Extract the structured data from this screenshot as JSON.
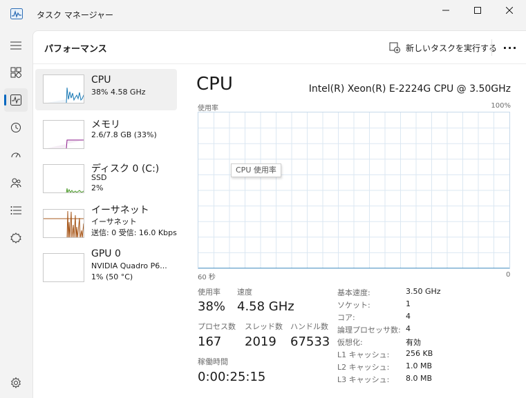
{
  "window": {
    "title": "タスク マネージャー"
  },
  "nav": {
    "items": [
      {
        "icon": "hamburger-menu-icon"
      },
      {
        "icon": "processes-icon"
      },
      {
        "icon": "performance-icon",
        "active": true
      },
      {
        "icon": "app-history-icon"
      },
      {
        "icon": "startup-apps-icon"
      },
      {
        "icon": "users-icon"
      },
      {
        "icon": "details-icon"
      },
      {
        "icon": "services-icon"
      },
      {
        "icon": "settings-icon"
      }
    ]
  },
  "header": {
    "title": "パフォーマンス",
    "run_task_label": "新しいタスクを実行する",
    "more_label": "···"
  },
  "resources": [
    {
      "name": "CPU",
      "line1": "38%  4.58 GHz",
      "line2": ""
    },
    {
      "name": "メモリ",
      "line1": "2.6/7.8 GB (33%)",
      "line2": ""
    },
    {
      "name": "ディスク 0 (C:)",
      "line1": "SSD",
      "line2": "2%"
    },
    {
      "name": "イーサネット",
      "line1": "イーサネット",
      "line2": "送信: 0  受信: 16.0 Kbps"
    },
    {
      "name": "GPU 0",
      "line1": "NVIDIA Quadro P6...",
      "line2": "1%  (50 °C)"
    }
  ],
  "detail": {
    "title": "CPU",
    "model": "Intel(R) Xeon(R) E-2224G CPU @ 3.50GHz",
    "graph_label_top_left": "使用率",
    "graph_label_top_right": "100%",
    "graph_label_bottom_left": "60 秒",
    "graph_label_bottom_right": "0",
    "tooltip": "CPU 使用率"
  },
  "stats": {
    "usage_label": "使用率",
    "usage_value": "38%",
    "speed_label": "速度",
    "speed_value": "4.58 GHz",
    "processes_label": "プロセス数",
    "processes_value": "167",
    "threads_label": "スレッド数",
    "threads_value": "2019",
    "handles_label": "ハンドル数",
    "handles_value": "67533",
    "uptime_label": "稼働時間",
    "uptime_value": "0:00:25:15"
  },
  "specs": [
    {
      "key": "基本速度:",
      "value": "3.50 GHz"
    },
    {
      "key": "ソケット:",
      "value": "1"
    },
    {
      "key": "コア:",
      "value": "4"
    },
    {
      "key": "論理プロセッサ数:",
      "value": "4"
    },
    {
      "key": "仮想化:",
      "value": "有効"
    },
    {
      "key": "L1 キャッシュ:",
      "value": "256 KB"
    },
    {
      "key": "L2 キャッシュ:",
      "value": "1.0 MB"
    },
    {
      "key": "L3 キャッシュ:",
      "value": "8.0 MB"
    }
  ],
  "colors": {
    "cpu": "#1a7ab5",
    "cpu_fill": "#f1f6fa",
    "memory": "#8b1a8b",
    "disk": "#4c9a2a",
    "ethernet": "#a7581c",
    "grid": "#dbe7f2"
  },
  "chart_data": {
    "type": "line",
    "ylim": [
      0,
      100
    ],
    "xlim": [
      60,
      0
    ],
    "x": [
      60,
      59,
      58,
      57,
      56,
      55,
      54,
      53,
      52,
      51,
      50,
      49,
      48,
      47,
      46,
      45,
      44,
      43,
      42,
      41,
      40,
      39,
      38,
      37,
      36,
      35,
      34,
      33,
      32,
      31,
      30,
      29,
      28,
      27,
      26,
      25,
      24,
      23,
      22,
      21,
      20,
      19,
      18,
      17,
      16,
      15,
      14,
      13,
      12,
      11,
      10,
      9,
      8,
      7,
      6,
      5,
      4,
      3,
      2,
      1,
      0
    ],
    "series": [
      {
        "values": [
          0,
          0,
          0,
          0,
          0,
          0,
          0,
          0,
          0,
          0,
          0,
          0,
          0,
          0,
          0,
          0,
          0,
          0,
          0,
          0,
          0,
          0,
          0,
          0,
          0,
          0,
          0,
          0,
          0,
          0,
          0,
          0,
          0,
          0,
          0,
          0,
          0,
          0,
          0,
          0,
          0,
          0,
          0,
          0,
          0,
          0,
          0,
          0,
          0,
          0,
          0,
          0,
          0,
          0,
          0,
          0,
          0,
          0,
          0,
          0,
          0
        ]
      },
      {
        "values": [
          0,
          0,
          0,
          0,
          0,
          0,
          0,
          0,
          0,
          0,
          0,
          0,
          0,
          0,
          0,
          0,
          0,
          0,
          0,
          0,
          0,
          0,
          0,
          0,
          0,
          0,
          0,
          0,
          0,
          0,
          0,
          0,
          0,
          0,
          0,
          0,
          0,
          0,
          0,
          0,
          0,
          0,
          0,
          0,
          0,
          0,
          0,
          0,
          0,
          0,
          0,
          0,
          0,
          0,
          0,
          0,
          0,
          0,
          0,
          0,
          0
        ]
      }
    ],
    "cpu_values": [
      0,
      0,
      0,
      0,
      0,
      0,
      0,
      0,
      0,
      0,
      0,
      0,
      0,
      0,
      0,
      0,
      0,
      0,
      0,
      0,
      0,
      0,
      0,
      0,
      0,
      0,
      0,
      0,
      0,
      0,
      0,
      0,
      0,
      0,
      0,
      0,
      0,
      0,
      0,
      0,
      0,
      0,
      0,
      0,
      0,
      0,
      0,
      0,
      0,
      0,
      0,
      0,
      0,
      0,
      0,
      0,
      0,
      0,
      0,
      0,
      0
    ]
  }
}
